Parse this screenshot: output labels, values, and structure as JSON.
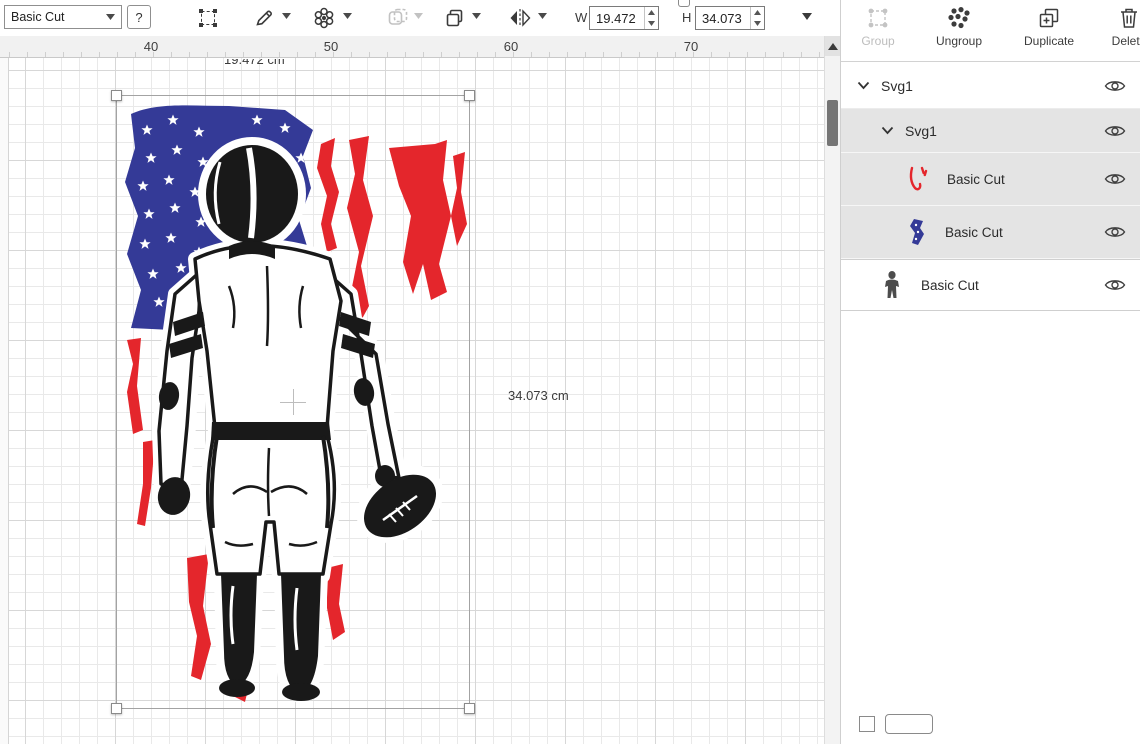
{
  "toolbar": {
    "linetype": {
      "value": "Basic Cut"
    },
    "help": "?",
    "width": {
      "label": "W",
      "value": "19.472"
    },
    "height": {
      "label": "H",
      "value": "34.073"
    }
  },
  "ruler": {
    "ticks": [
      "40",
      "50",
      "60",
      "70"
    ]
  },
  "canvas": {
    "selection": {
      "width_label": "19.472 cm",
      "height_label": "34.073 cm"
    }
  },
  "panel": {
    "actions": {
      "group": "Group",
      "ungroup": "Ungroup",
      "duplicate": "Duplicate",
      "delete": "Delete"
    },
    "layers": [
      {
        "label": "Svg1"
      },
      {
        "label": "Svg1"
      },
      {
        "label": "Basic Cut"
      },
      {
        "label": "Basic Cut"
      },
      {
        "label": "Basic Cut"
      }
    ]
  },
  "colors": {
    "flag_blue": "#343a97",
    "flag_red": "#e4262c",
    "ink": "#191919"
  }
}
